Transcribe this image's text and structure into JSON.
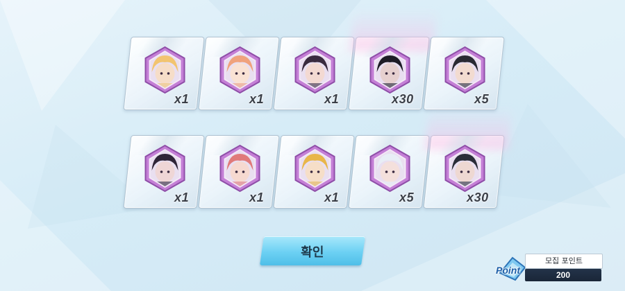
{
  "rewards": [
    {
      "character": "blonde-glasses",
      "count": "x1",
      "glow": false
    },
    {
      "character": "pink-orange-hair",
      "count": "x1",
      "glow": false
    },
    {
      "character": "dark-hair-purple",
      "count": "x1",
      "glow": false
    },
    {
      "character": "black-hair-masked",
      "count": "x30",
      "glow": true
    },
    {
      "character": "dark-hair-cat",
      "count": "x5",
      "glow": false
    },
    {
      "character": "dark-hair-violet",
      "count": "x1",
      "glow": false
    },
    {
      "character": "red-hair",
      "count": "x1",
      "glow": false
    },
    {
      "character": "blonde-short",
      "count": "x1",
      "glow": false
    },
    {
      "character": "white-hair-horns",
      "count": "x5",
      "glow": false
    },
    {
      "character": "white-cap-dark",
      "count": "x30",
      "glow": true
    }
  ],
  "confirm_label": "확인",
  "points": {
    "title": "모집 포인트",
    "value": "200",
    "badge": "Point"
  },
  "colors": {
    "hex_frame": "#c47fd6",
    "accent": "#6cd0f3",
    "panel_dark": "#1a2638"
  },
  "portrait_colors": [
    {
      "hair": "#f2c470",
      "skin": "#f6ddc8"
    },
    {
      "hair": "#f0a27c",
      "skin": "#f9e2d4"
    },
    {
      "hair": "#3a2b3f",
      "skin": "#f3d9d2"
    },
    {
      "hair": "#1e1c26",
      "skin": "#e6d0cf"
    },
    {
      "hair": "#2a2a33",
      "skin": "#f2dbd0"
    },
    {
      "hair": "#2f2538",
      "skin": "#efd6d6"
    },
    {
      "hair": "#e07a7a",
      "skin": "#f6d9d0"
    },
    {
      "hair": "#e8b64a",
      "skin": "#f6dec8"
    },
    {
      "hair": "#e8eef6",
      "skin": "#f4e0dc"
    },
    {
      "hair": "#2a2d38",
      "skin": "#eed8d2"
    }
  ]
}
